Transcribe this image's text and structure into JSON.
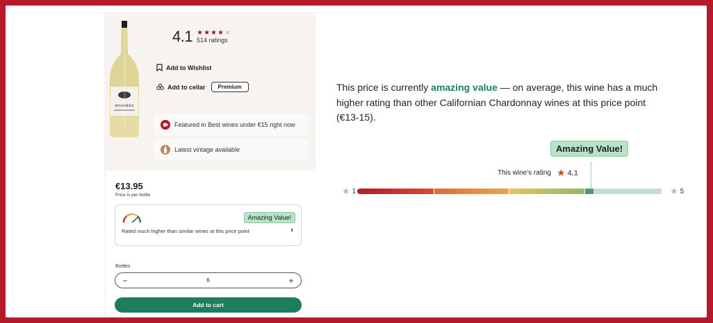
{
  "product": {
    "rating": "4.1",
    "stars_filled": 4,
    "stars_total": 5,
    "rating_count": "514 ratings",
    "wishlist_label": "Add to Wishlist",
    "cellar_label": "Add to cellar",
    "premium_label": "Premium",
    "featured_text": "Featured in Best wines under €15 right now",
    "vintage_text": "Latest vintage available",
    "bottle_label": "PANAMERA"
  },
  "purchase": {
    "price": "€13.95",
    "price_note": "Price is per bottle",
    "value_badge": "Amazing Value!",
    "value_description": "Rated much higher than similar wines at this price point",
    "bottles_label": "Bottles",
    "quantity": "6",
    "minus": "−",
    "plus": "+",
    "add_to_cart": "Add to cart"
  },
  "explanation": {
    "prefix": "This price is currently ",
    "highlight": "amazing value",
    "suffix": " — on average, this wine has a much higher rating than other Californian Chardonnay wines at this price point (€13-15)."
  },
  "scale": {
    "callout": "Amazing Value!",
    "wine_rating_label": "This wine's rating",
    "wine_rating": "4.1",
    "min_label": "1",
    "max_label": "5"
  },
  "colors": {
    "accent_green": "#1d7d5c",
    "badge_green": "#b7e3c6",
    "star_red": "#8a1d2c",
    "frame_red": "#b51a2b"
  }
}
